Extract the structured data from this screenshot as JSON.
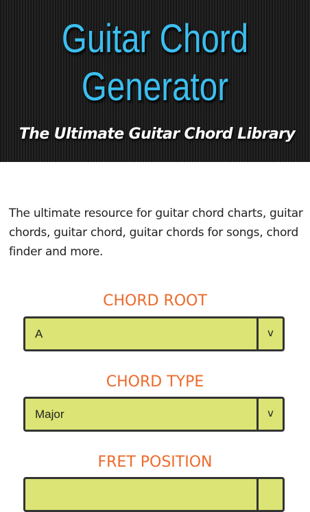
{
  "header": {
    "title_line1": "Guitar Chord",
    "title_line2": "Generator",
    "subtitle": "The Ultimate Guitar Chord Library"
  },
  "intro": {
    "text": "The ultimate resource for guitar chord charts, guitar chords, guitar chord, guitar chords for songs, chord finder and more."
  },
  "form": {
    "chord_root": {
      "label": "CHORD ROOT",
      "value": "A",
      "arrow": "v"
    },
    "chord_type": {
      "label": "CHORD TYPE",
      "value": "Major",
      "arrow": "v"
    },
    "fret_position": {
      "label": "FRET POSITION",
      "value": "",
      "arrow": ""
    }
  },
  "colors": {
    "title": "#3cbff0",
    "label": "#ec6a2b",
    "select_bg": "#dbe475",
    "header_bg": "#1c1c1c"
  }
}
